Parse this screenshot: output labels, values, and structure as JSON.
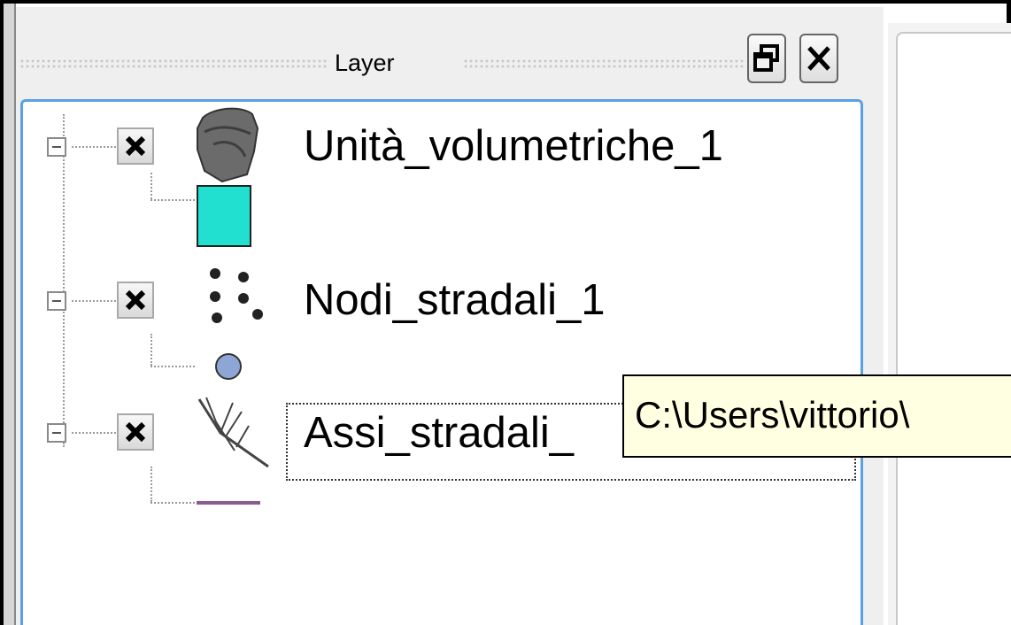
{
  "panel": {
    "title": "Layer",
    "float_icon": "restore-window-icon",
    "close_icon": "close-icon"
  },
  "layers": [
    {
      "name": "Unità_volumetriche_1",
      "visible": true,
      "type_icon": "polygon-layer-icon",
      "symbol": "teal-fill-square",
      "symbol_color": "#22e0cf"
    },
    {
      "name": "Nodi_stradali_1",
      "visible": true,
      "type_icon": "point-layer-icon",
      "symbol": "blue-circle",
      "symbol_color": "#8ea6d6"
    },
    {
      "name": "Assi_stradali_",
      "visible": true,
      "type_icon": "line-layer-icon",
      "symbol": "purple-line",
      "symbol_color": "#8d5a94"
    }
  ],
  "tooltip": {
    "text": "C:\\Users\\vittorio\\"
  },
  "colors": {
    "tree_border": "#5aa0e6",
    "tooltip_bg": "#ffffe1"
  }
}
